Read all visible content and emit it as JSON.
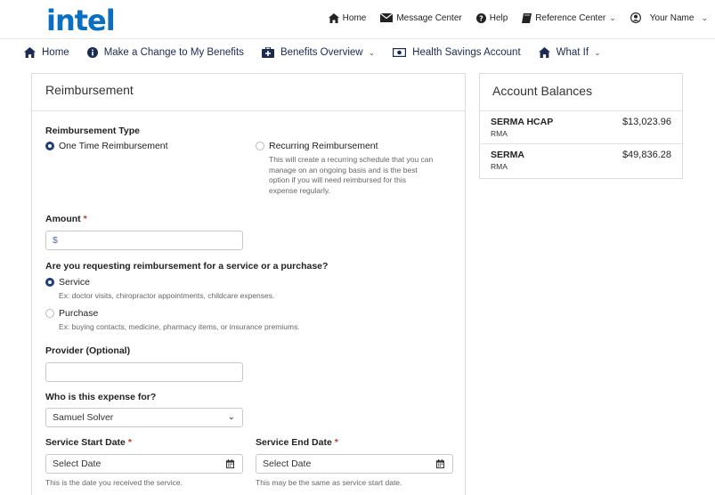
{
  "header": {
    "logo": "intel",
    "links": [
      {
        "label": "Home",
        "icon": "home-icon"
      },
      {
        "label": "Message Center",
        "icon": "envelope-icon"
      },
      {
        "label": "Help",
        "icon": "question-circle-icon"
      },
      {
        "label": "Reference Center",
        "icon": "book-icon"
      },
      {
        "label": "Your Name",
        "icon": "user-circle-icon"
      }
    ]
  },
  "nav": {
    "items": [
      {
        "label": "Home",
        "icon": "home-icon"
      },
      {
        "label": "Make a Change to My Benefits",
        "icon": "info-circle-icon"
      },
      {
        "label": "Benefits Overview",
        "icon": "medkit-icon"
      },
      {
        "label": "Health Savings Account",
        "icon": "money-icon"
      },
      {
        "label": "What If",
        "icon": "home-icon"
      }
    ]
  },
  "form": {
    "title": "Reimbursement",
    "reimb_type_label": "Reimbursement Type",
    "one_time": "One Time Reimbursement",
    "recurring": "Recurring Reimbursement",
    "recurring_hint": [
      "This will create a recurring schedule that you can",
      "manage on an ongoing basis and is the best",
      "option if you will need reimbursed for this",
      "expense regularly."
    ],
    "amount_label": "Amount",
    "required_mark": "*",
    "amount_value": "$",
    "service_question": "Are you requesting reimbursement for a service or a purchase?",
    "service": "Service",
    "service_hint": "Ex: doctor visits, chiropractor appointments, childcare expenses.",
    "purchase": "Purchase",
    "purchase_hint": "Ex: buying contacts, medicine, pharmacy items, or insurance premiums.",
    "provider_label": "Provider (Optional)",
    "provider_value": "",
    "who_label": "Who is this expense for?",
    "who_value": "Samuel Solver",
    "start_label": "Service Start Date",
    "start_placeholder": "Select Date",
    "start_hint": "This is the date you received the service.",
    "end_label": "Service End Date",
    "end_placeholder": "Select Date",
    "end_hint": "This may be the same as service start date."
  },
  "balances": {
    "title": "Account Balances",
    "accounts": [
      {
        "name": "SERMA HCAP",
        "type": "RMA",
        "amount": "$13,023.96"
      },
      {
        "name": "SERMA",
        "type": "RMA",
        "amount": "$49,836.28"
      }
    ]
  },
  "colors": {
    "brand": "#0a6fc2",
    "nav_text": "#1a2a50",
    "radio_selected": "#1f3f7a",
    "required": "#c0392b"
  }
}
